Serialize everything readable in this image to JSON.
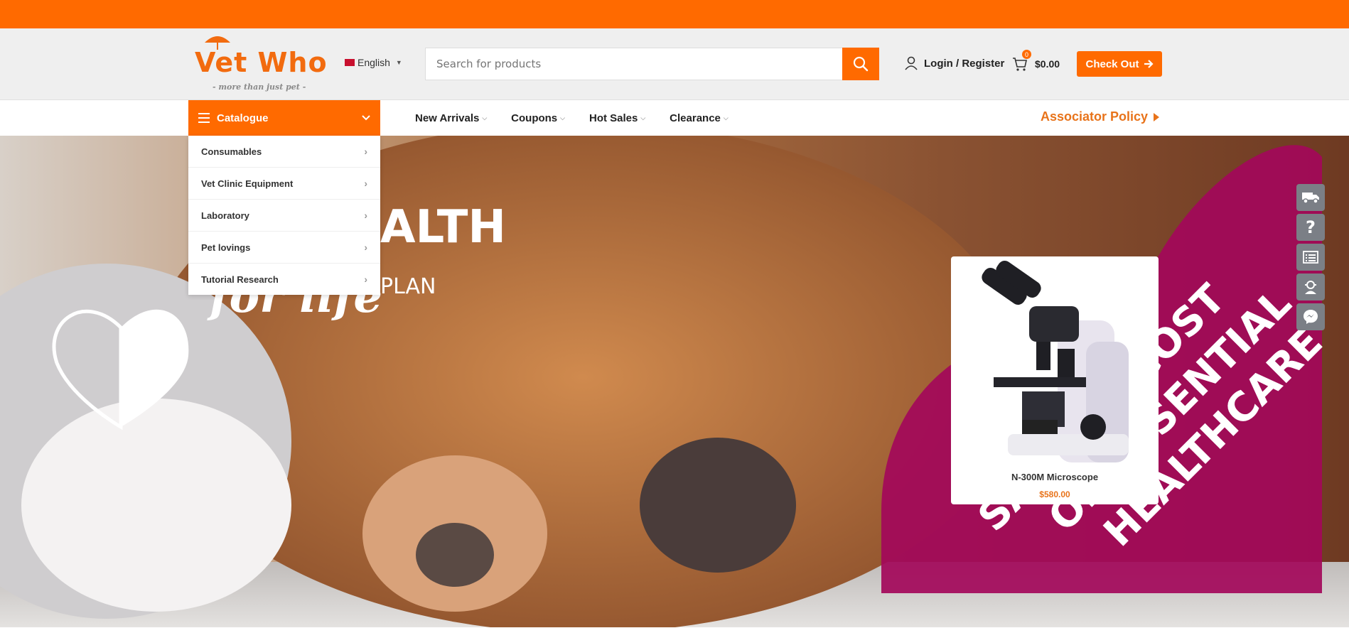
{
  "brand": {
    "logo_text": "Vet Who",
    "tagline": "- more than just pet -",
    "accent_color": "#ff6a00",
    "logo_color": "#f26b0f"
  },
  "header": {
    "language": "English",
    "search_placeholder": "Search for products",
    "login_label": "Login / Register",
    "cart_count": "0",
    "cart_total": "$0.00",
    "checkout_label": "Check Out"
  },
  "nav": {
    "catalogue_label": "Catalogue",
    "items": [
      {
        "label": "New Arrivals"
      },
      {
        "label": "Coupons"
      },
      {
        "label": "Hot Sales"
      },
      {
        "label": "Clearance"
      }
    ],
    "policy_label": "Associator Policy"
  },
  "catalogue_menu": [
    {
      "label": "Consumables"
    },
    {
      "label": "Vet Clinic Equipment"
    },
    {
      "label": "Laboratory"
    },
    {
      "label": "Pet lovings"
    },
    {
      "label": "Tutorial Research"
    }
  ],
  "hero": {
    "headline_partial": "ALTH",
    "sub_partial": "PLAN",
    "script_partial": "for life",
    "promo_lines": [
      "SAVE ON COST",
      "ON ESSENTIAL",
      "HEALTHCARE"
    ]
  },
  "product": {
    "name": "N-300M Microscope",
    "price": "$580.00"
  },
  "side_tools": [
    {
      "icon": "truck-icon"
    },
    {
      "icon": "question-icon"
    },
    {
      "icon": "list-icon"
    },
    {
      "icon": "support-agent-icon"
    },
    {
      "icon": "messenger-icon"
    }
  ]
}
